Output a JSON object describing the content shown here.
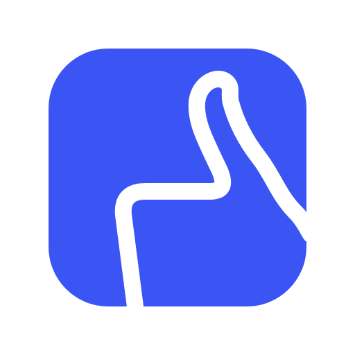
{
  "icon": {
    "name": "thumbs-up-icon",
    "background_color": "#ffffff",
    "tile_color": "#3b55f5",
    "stroke_color": "#ffffff"
  }
}
